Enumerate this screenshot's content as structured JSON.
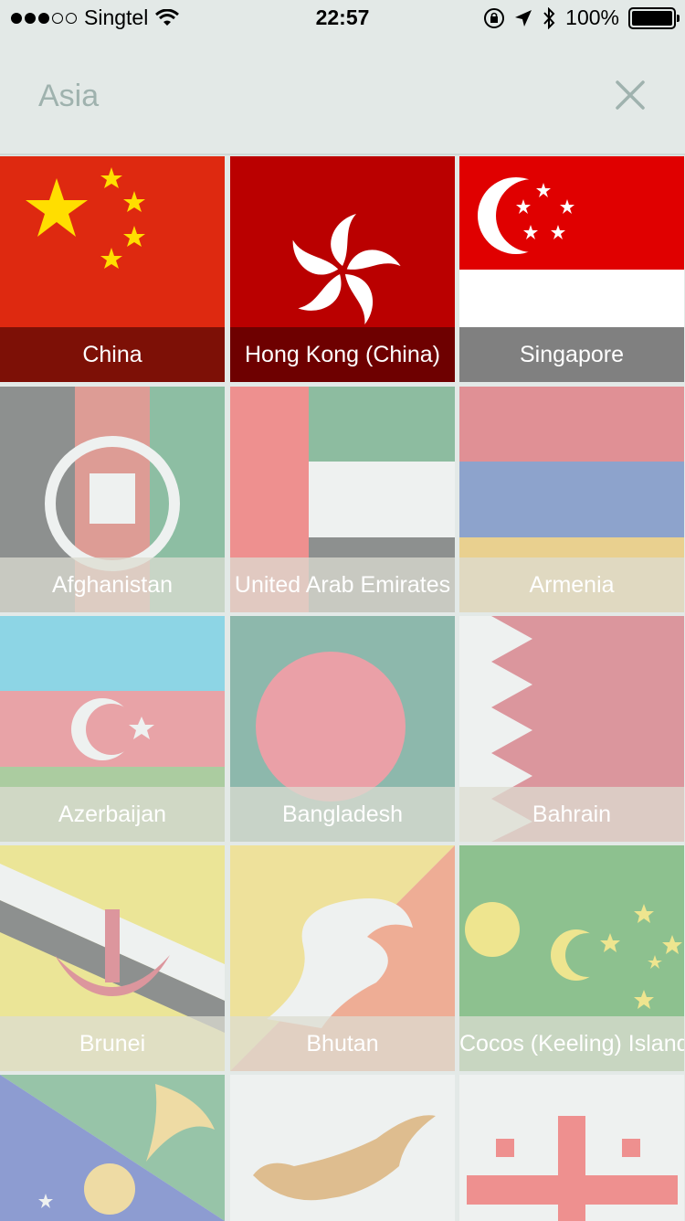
{
  "status_bar": {
    "carrier": "Singtel",
    "time": "22:57",
    "battery": "100%"
  },
  "search": {
    "value": "Asia"
  },
  "countries": [
    {
      "name": "China"
    },
    {
      "name": "Hong Kong (China)"
    },
    {
      "name": "Singapore"
    },
    {
      "name": "Afghanistan"
    },
    {
      "name": "United Arab Emirates"
    },
    {
      "name": "Armenia"
    },
    {
      "name": "Azerbaijan"
    },
    {
      "name": "Bangladesh"
    },
    {
      "name": "Bahrain"
    },
    {
      "name": "Brunei"
    },
    {
      "name": "Bhutan"
    },
    {
      "name": "Cocos (Keeling) Islands"
    }
  ],
  "colors": {
    "background": "#e3e9e7",
    "china_red": "#de2910",
    "hk_red": "#ba0000",
    "singapore_red": "#e00000",
    "star_yellow": "#ffde00"
  }
}
